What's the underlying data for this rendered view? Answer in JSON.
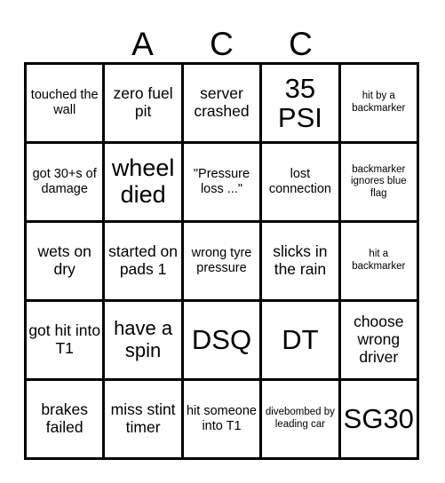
{
  "card": {
    "title_letters": [
      "",
      "A",
      "C",
      "C",
      ""
    ],
    "columns": 5,
    "rows": 5,
    "line_color": "#000000",
    "background_color": "#ffffff",
    "text_color": "#000000",
    "cells": [
      [
        {
          "text": "touched the wall",
          "size": "sm"
        },
        {
          "text": "zero fuel pit",
          "size": "md"
        },
        {
          "text": "server crashed",
          "size": "md"
        },
        {
          "text": "35 PSI",
          "size": "xxl"
        },
        {
          "text": "hit by a backmarker",
          "size": "xs"
        }
      ],
      [
        {
          "text": "got 30+s of damage",
          "size": "sm"
        },
        {
          "text": "wheel died",
          "size": "xl"
        },
        {
          "text": "\"Pressure loss ...\"",
          "size": "sm"
        },
        {
          "text": "lost connection",
          "size": "sm"
        },
        {
          "text": "backmarker ignores blue flag",
          "size": "xs"
        }
      ],
      [
        {
          "text": "wets on dry",
          "size": "md"
        },
        {
          "text": "started on pads 1",
          "size": "md"
        },
        {
          "text": "wrong tyre pressure",
          "size": "sm"
        },
        {
          "text": "slicks in the rain",
          "size": "md"
        },
        {
          "text": "hit a backmarker",
          "size": "xs"
        }
      ],
      [
        {
          "text": "got hit into T1",
          "size": "md"
        },
        {
          "text": "have a spin",
          "size": "lg"
        },
        {
          "text": "DSQ",
          "size": "xxl"
        },
        {
          "text": "DT",
          "size": "xxl"
        },
        {
          "text": "choose wrong driver",
          "size": "md"
        }
      ],
      [
        {
          "text": "brakes failed",
          "size": "md"
        },
        {
          "text": "miss stint timer",
          "size": "md"
        },
        {
          "text": "hit someone into T1",
          "size": "sm"
        },
        {
          "text": "divebombed by leading car",
          "size": "xs"
        },
        {
          "text": "SG30",
          "size": "xxl"
        }
      ]
    ]
  }
}
